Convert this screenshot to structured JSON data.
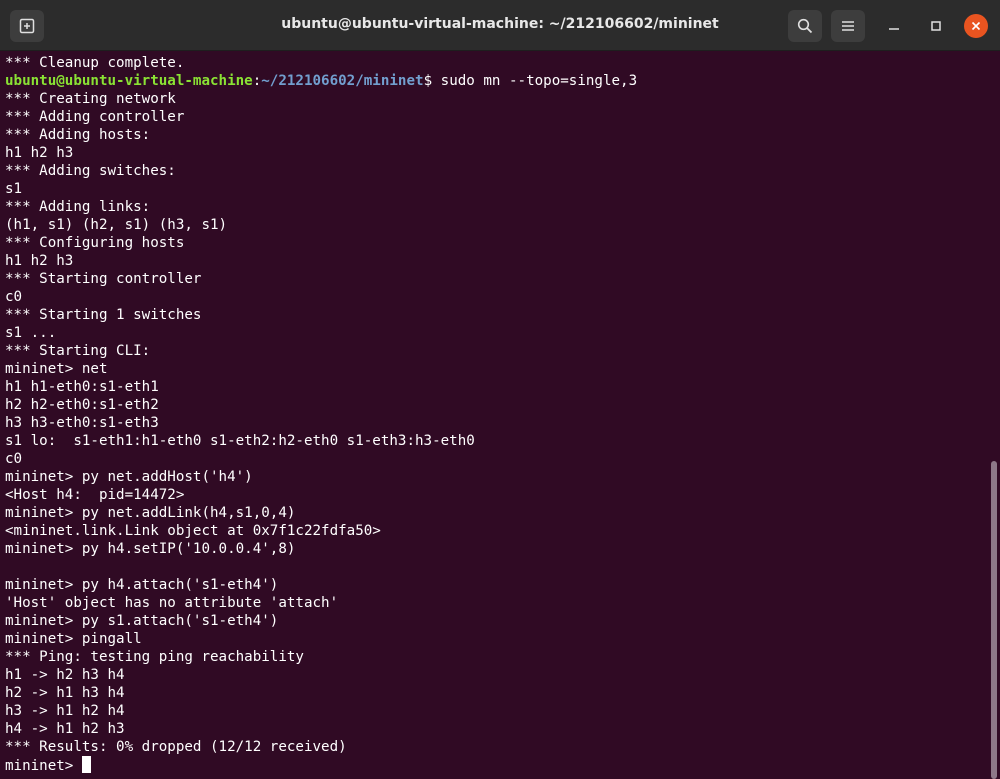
{
  "window": {
    "title": "ubuntu@ubuntu-virtual-machine: ~/212106602/mininet"
  },
  "titlebar": {
    "new_tab_icon": "new-tab-icon",
    "search_icon": "search-icon",
    "menu_icon": "hamburger-menu-icon",
    "minimize_icon": "minimize-icon",
    "maximize_icon": "maximize-icon",
    "close_icon": "close-icon"
  },
  "colors": {
    "background": "#300a24",
    "text": "#ffffff",
    "prompt_user": "#8ae234",
    "prompt_path": "#729fcf",
    "close_button": "#e95420"
  },
  "terminal": {
    "lines": [
      "*** Cleanup complete.",
      "",
      "*** Creating network",
      "*** Adding controller",
      "*** Adding hosts:",
      "h1 h2 h3",
      "*** Adding switches:",
      "s1",
      "*** Adding links:",
      "(h1, s1) (h2, s1) (h3, s1)",
      "*** Configuring hosts",
      "h1 h2 h3",
      "*** Starting controller",
      "c0",
      "*** Starting 1 switches",
      "s1 ...",
      "*** Starting CLI:",
      "mininet> net",
      "h1 h1-eth0:s1-eth1",
      "h2 h2-eth0:s1-eth2",
      "h3 h3-eth0:s1-eth3",
      "s1 lo:  s1-eth1:h1-eth0 s1-eth2:h2-eth0 s1-eth3:h3-eth0",
      "c0",
      "mininet> py net.addHost('h4')",
      "<Host h4:  pid=14472>",
      "mininet> py net.addLink(h4,s1,0,4)",
      "<mininet.link.Link object at 0x7f1c22fdfa50>",
      "mininet> py h4.setIP('10.0.0.4',8)",
      "",
      "mininet> py h4.attach('s1-eth4')",
      "'Host' object has no attribute 'attach'",
      "mininet> py s1.attach('s1-eth4')",
      "mininet> pingall",
      "*** Ping: testing ping reachability",
      "h1 -> h2 h3 h4",
      "h2 -> h1 h3 h4",
      "h3 -> h1 h2 h4",
      "h4 -> h1 h2 h3",
      "*** Results: 0% dropped (12/12 received)"
    ],
    "prompt": {
      "user_host": "ubuntu@ubuntu-virtual-machine",
      "separator": ":",
      "path": "~/212106602/mininet",
      "symbol": "$ ",
      "command": "sudo mn --topo=single,3"
    },
    "current_prompt": "mininet> "
  }
}
